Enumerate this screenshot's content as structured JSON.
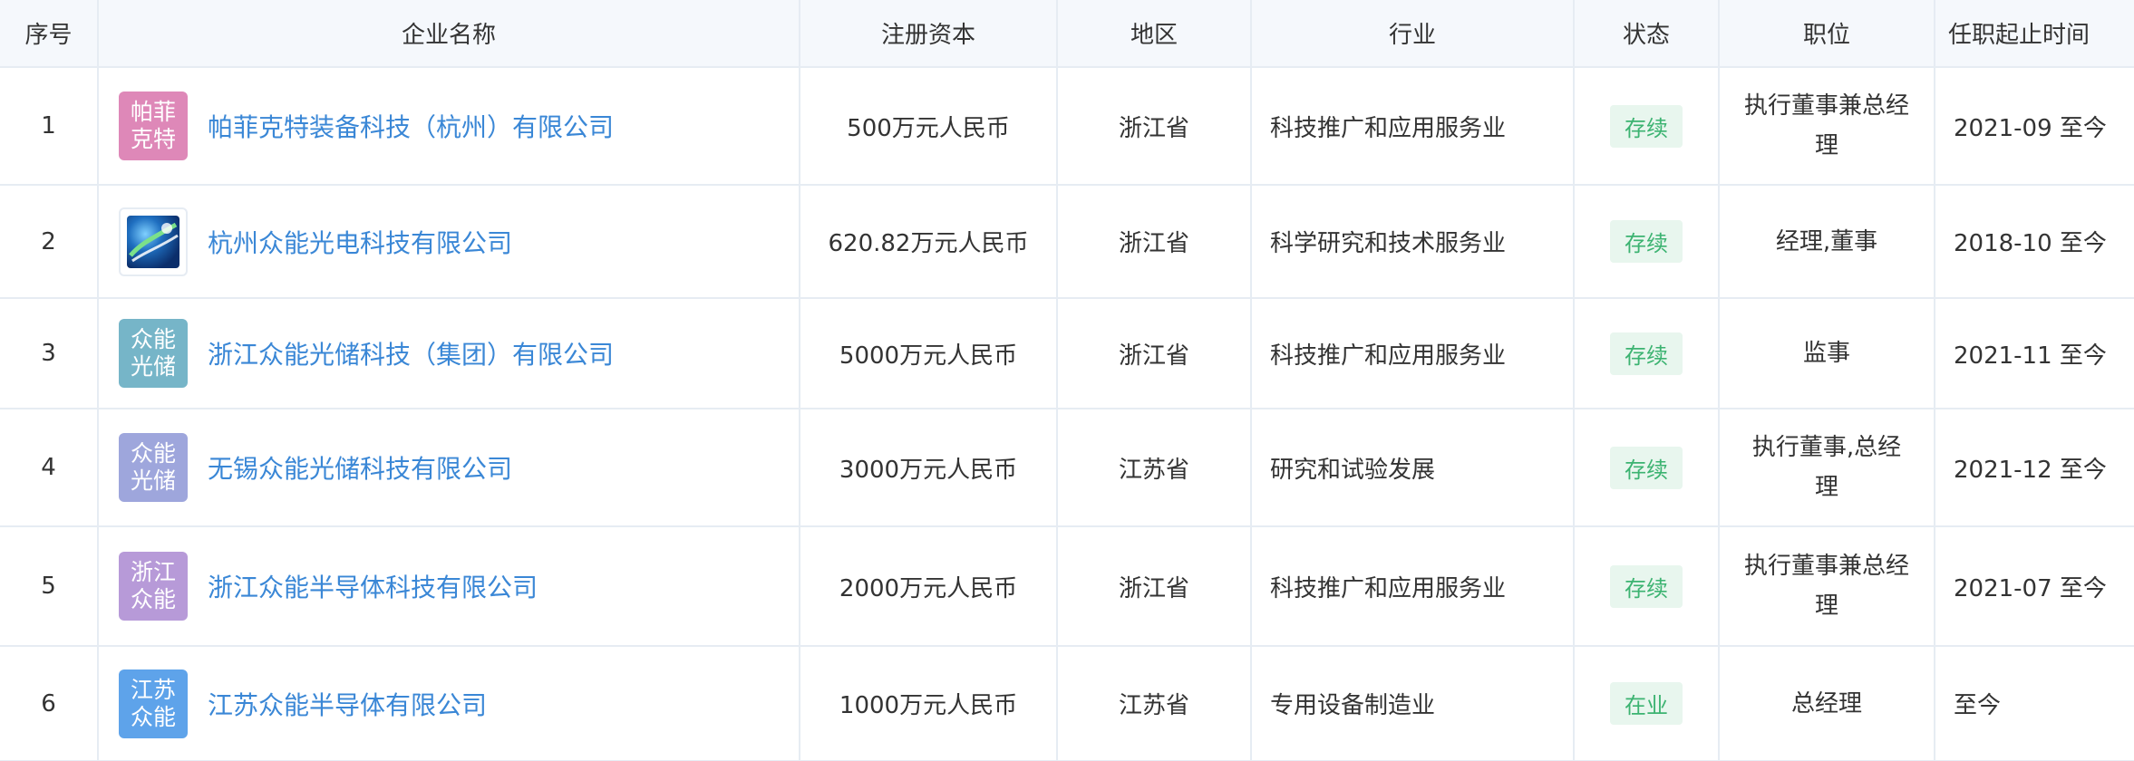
{
  "headers": {
    "index": "序号",
    "name": "企业名称",
    "capital": "注册资本",
    "region": "地区",
    "industry": "行业",
    "status": "状态",
    "position": "职位",
    "tenure": "任职起止时间"
  },
  "rows": [
    {
      "index": "1",
      "logo_text": "帕菲克特",
      "logo_color": "#de88b8",
      "name": "帕菲克特装备科技（杭州）有限公司",
      "capital": "500万元人民币",
      "region": "浙江省",
      "industry": "科技推广和应用服务业",
      "status": "存续",
      "position": "执行董事兼总经理",
      "tenure": "2021-09 至今"
    },
    {
      "index": "2",
      "logo_text": "",
      "logo_icon": "globe-logo-icon",
      "name": "杭州众能光电科技有限公司",
      "capital": "620.82万元人民币",
      "region": "浙江省",
      "industry": "科学研究和技术服务业",
      "status": "存续",
      "position": "经理,董事",
      "tenure": "2018-10 至今"
    },
    {
      "index": "3",
      "logo_text": "众能光储",
      "logo_color": "#76b5c8",
      "name": "浙江众能光储科技（集团）有限公司",
      "capital": "5000万元人民币",
      "region": "浙江省",
      "industry": "科技推广和应用服务业",
      "status": "存续",
      "position": "监事",
      "tenure": "2021-11 至今"
    },
    {
      "index": "4",
      "logo_text": "众能光储",
      "logo_color": "#9ea6dc",
      "name": "无锡众能光储科技有限公司",
      "capital": "3000万元人民币",
      "region": "江苏省",
      "industry": "研究和试验发展",
      "status": "存续",
      "position": "执行董事,总经理",
      "tenure": "2021-12 至今"
    },
    {
      "index": "5",
      "logo_text": "浙江众能",
      "logo_color": "#b79ad8",
      "name": "浙江众能半导体科技有限公司",
      "capital": "2000万元人民币",
      "region": "浙江省",
      "industry": "科技推广和应用服务业",
      "status": "存续",
      "position": "执行董事兼总经理",
      "tenure": "2021-07 至今"
    },
    {
      "index": "6",
      "logo_text": "江苏众能",
      "logo_color": "#5ea3ea",
      "name": "江苏众能半导体有限公司",
      "capital": "1000万元人民币",
      "region": "江苏省",
      "industry": "专用设备制造业",
      "status": "在业",
      "position": "总经理",
      "tenure": "至今"
    }
  ],
  "colors": {
    "link": "#3a87d6",
    "header_bg": "#f5f8fc",
    "border": "#e6ecf3",
    "status_bg": "#e8f6ee",
    "status_text": "#3cb371"
  }
}
